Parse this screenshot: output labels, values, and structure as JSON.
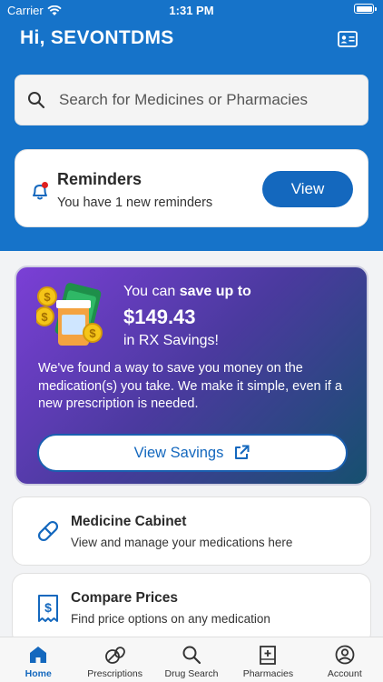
{
  "status_bar": {
    "carrier": "Carrier",
    "time": "1:31 PM"
  },
  "header": {
    "greeting": "Hi, SEVONTDMS"
  },
  "search": {
    "placeholder": "Search for Medicines or Pharmacies"
  },
  "reminders": {
    "title": "Reminders",
    "subtitle": "You have 1 new reminders",
    "button_label": "View"
  },
  "promo": {
    "line1_prefix": "You can ",
    "line1_bold": "save up to",
    "amount": "$149.43",
    "line3": "in RX Savings!",
    "body": "We've found a way to save you money on the medication(s) you take. We make it simple, even if a new prescription is needed.",
    "button_label": "View Savings"
  },
  "cards": [
    {
      "title": "Medicine Cabinet",
      "subtitle": "View and manage your medications here",
      "icon": "pill-icon"
    },
    {
      "title": "Compare Prices",
      "subtitle": "Find price options on any medication",
      "icon": "receipt-dollar-icon"
    }
  ],
  "tabs": [
    {
      "label": "Home",
      "icon": "home-icon",
      "active": true
    },
    {
      "label": "Prescriptions",
      "icon": "prescriptions-icon",
      "active": false
    },
    {
      "label": "Drug Search",
      "icon": "search-icon",
      "active": false
    },
    {
      "label": "Pharmacies",
      "icon": "pharmacy-icon",
      "active": false
    },
    {
      "label": "Account",
      "icon": "account-icon",
      "active": false
    }
  ],
  "colors": {
    "brand_blue": "#1673c9",
    "button_blue": "#1468be",
    "promo_start": "#7b3fd6",
    "promo_end": "#16506f",
    "alert_red": "#e02020"
  }
}
